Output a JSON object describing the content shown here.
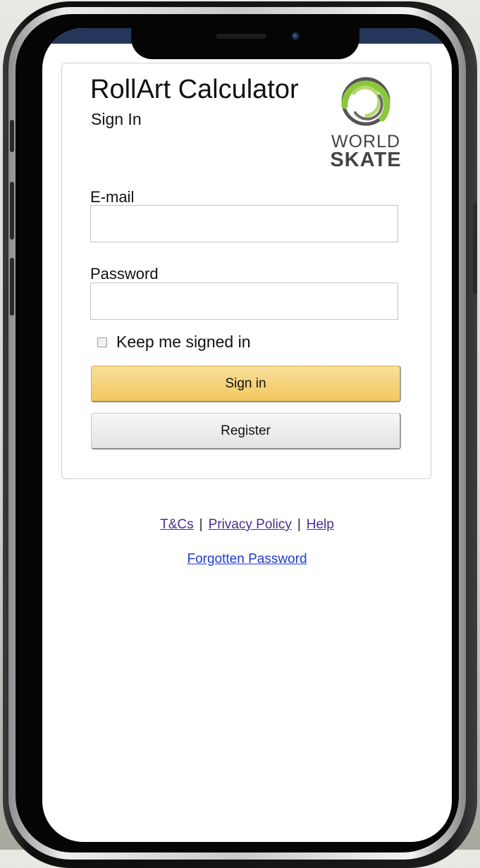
{
  "header": {
    "app_title": "RollArt Calculator",
    "subtitle": "Sign In"
  },
  "logo": {
    "line1": "WORLD",
    "line2": "SKATE",
    "ring_color": "#8cc63f"
  },
  "form": {
    "email_label": "E-mail",
    "email_value": "",
    "password_label": "Password",
    "password_value": "",
    "keep_signed_in_label": "Keep me signed in",
    "keep_signed_in_checked": false,
    "signin_label": "Sign in",
    "register_label": "Register"
  },
  "footer": {
    "links": [
      "T&Cs",
      "Privacy Policy",
      "Help"
    ],
    "separator": "|",
    "forgot_label": "Forgotten Password"
  },
  "colors": {
    "signin_button": "#f2c75f",
    "link_visited": "#4b2d8f",
    "link": "#1f3ccf",
    "status_bar": "#24375a"
  }
}
